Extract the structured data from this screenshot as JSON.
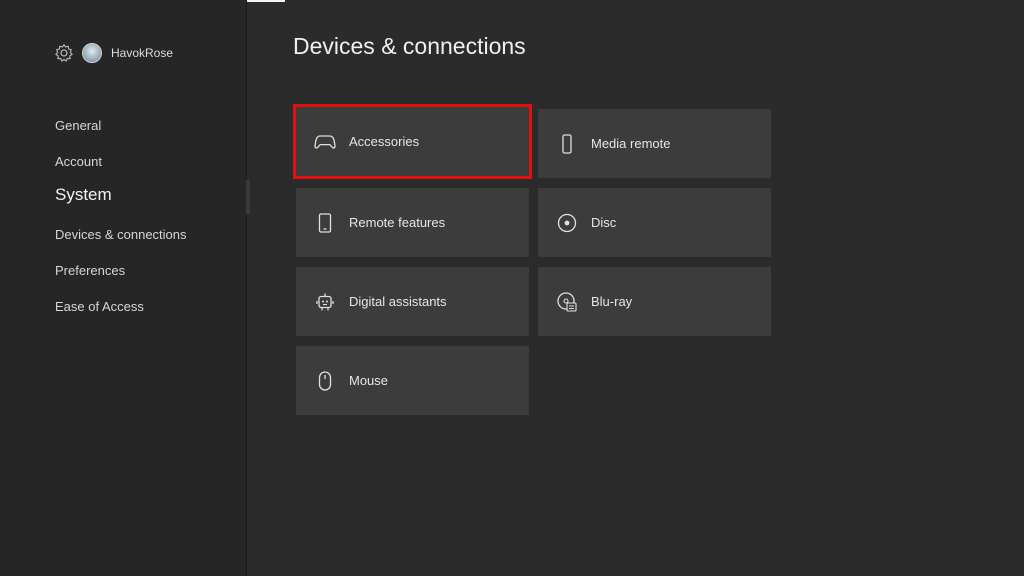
{
  "profile": {
    "username": "HavokRose"
  },
  "sidebar": {
    "items": [
      {
        "label": "General"
      },
      {
        "label": "Account"
      },
      {
        "label": "System"
      },
      {
        "label": "Devices & connections"
      },
      {
        "label": "Preferences"
      },
      {
        "label": "Ease of Access"
      }
    ]
  },
  "main": {
    "title": "Devices & connections",
    "tiles": [
      {
        "label": "Accessories",
        "icon": "controller-icon",
        "selected": true
      },
      {
        "label": "Media remote",
        "icon": "remote-icon"
      },
      {
        "label": "Remote features",
        "icon": "phone-icon"
      },
      {
        "label": "Disc",
        "icon": "disc-icon"
      },
      {
        "label": "Digital assistants",
        "icon": "assistant-icon"
      },
      {
        "label": "Blu-ray",
        "icon": "bluray-icon"
      },
      {
        "label": "Mouse",
        "icon": "mouse-icon"
      }
    ]
  },
  "colors": {
    "selection_outline": "#e01010",
    "tile_background": "#3c3c3c",
    "background": "#2b2b2b"
  }
}
